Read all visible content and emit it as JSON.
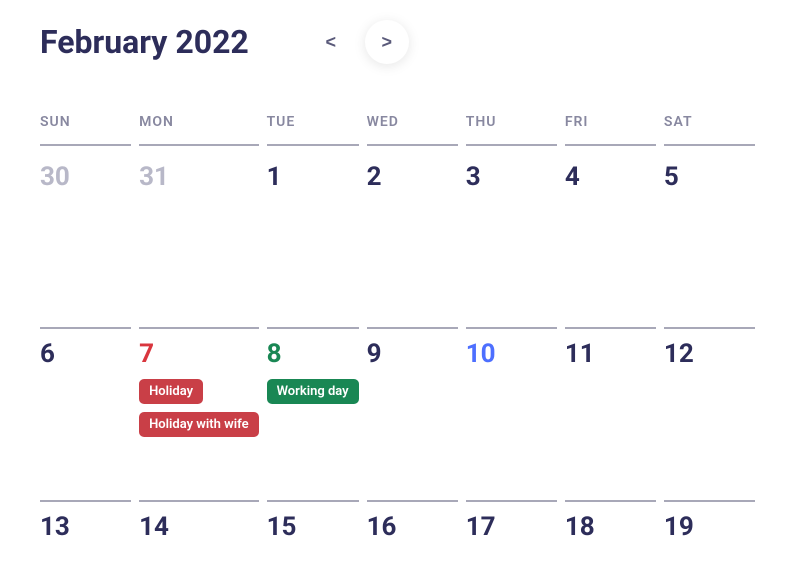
{
  "header": {
    "title": "February 2022",
    "prev": "<",
    "next": ">"
  },
  "weekdays": [
    "SUN",
    "MON",
    "TUE",
    "WED",
    "THU",
    "FRI",
    "SAT"
  ],
  "rows": [
    [
      {
        "num": "30",
        "style": "muted",
        "events": []
      },
      {
        "num": "31",
        "style": "muted",
        "events": []
      },
      {
        "num": "1",
        "style": "",
        "events": []
      },
      {
        "num": "2",
        "style": "",
        "events": []
      },
      {
        "num": "3",
        "style": "",
        "events": []
      },
      {
        "num": "4",
        "style": "",
        "events": []
      },
      {
        "num": "5",
        "style": "",
        "events": []
      }
    ],
    [
      {
        "num": "6",
        "style": "",
        "events": []
      },
      {
        "num": "7",
        "style": "red",
        "events": [
          {
            "label": "Holiday",
            "color": "red"
          },
          {
            "label": "Holiday with wife",
            "color": "red"
          }
        ]
      },
      {
        "num": "8",
        "style": "green",
        "events": [
          {
            "label": "Working day",
            "color": "green"
          }
        ]
      },
      {
        "num": "9",
        "style": "",
        "events": []
      },
      {
        "num": "10",
        "style": "blue",
        "events": []
      },
      {
        "num": "11",
        "style": "",
        "events": []
      },
      {
        "num": "12",
        "style": "",
        "events": []
      }
    ],
    [
      {
        "num": "13",
        "style": "",
        "events": []
      },
      {
        "num": "14",
        "style": "",
        "events": []
      },
      {
        "num": "15",
        "style": "",
        "events": []
      },
      {
        "num": "16",
        "style": "",
        "events": []
      },
      {
        "num": "17",
        "style": "",
        "events": []
      },
      {
        "num": "18",
        "style": "",
        "events": []
      },
      {
        "num": "19",
        "style": "",
        "events": []
      }
    ]
  ]
}
